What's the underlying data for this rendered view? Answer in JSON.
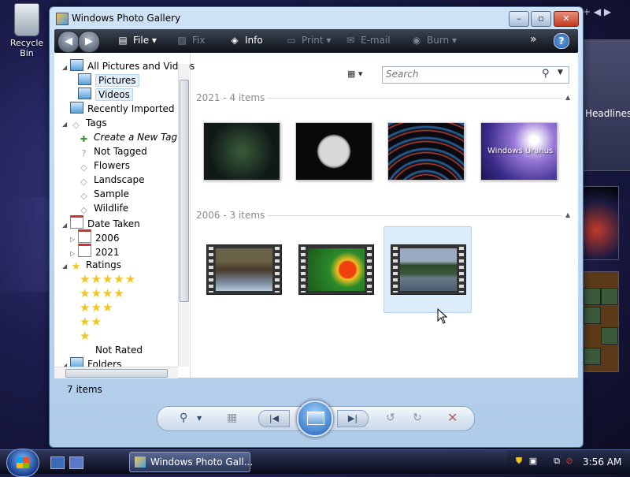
{
  "desktop": {
    "recycle_bin_label": "Recycle Bin",
    "gadget_headlines_label": "Headlines"
  },
  "window": {
    "title": "Windows Photo Gallery",
    "minimize": "–",
    "maximize": "▫",
    "close": "✕"
  },
  "toolbar": {
    "back": "◀",
    "forward": "▶",
    "file": "File",
    "fix": "Fix",
    "info": "Info",
    "print": "Print",
    "email": "E-mail",
    "burn": "Burn",
    "more": "»",
    "help": "?"
  },
  "search": {
    "placeholder": "Search"
  },
  "nav": {
    "all_pictures": "All Pictures and Videos",
    "pictures": "Pictures",
    "videos": "Videos",
    "recently_imported": "Recently Imported",
    "tags": "Tags",
    "create_tag": "Create a New Tag",
    "not_tagged": "Not Tagged",
    "flowers": "Flowers",
    "landscape": "Landscape",
    "sample": "Sample",
    "wildlife": "Wildlife",
    "date_taken": "Date Taken",
    "year_2006": "2006",
    "year_2021": "2021",
    "ratings": "Ratings",
    "stars_5": "★★★★★",
    "stars_4": "★★★★",
    "stars_3": "★★★",
    "stars_2": "★★",
    "stars_1": "★",
    "not_rated": "Not Rated",
    "folders": "Folders"
  },
  "groups": [
    {
      "heading": "2021 - 4 items"
    },
    {
      "heading": "2006 - 3 items"
    }
  ],
  "thumbnails": {
    "windows_uranus_text": "Windows Uranus"
  },
  "status": {
    "count": "7 items"
  },
  "controls": {
    "zoom": "⚲",
    "grid": "▦",
    "prev": "|◀",
    "next": "▶|",
    "rotate_left": "↺",
    "rotate_right": "↻",
    "delete": "✕"
  },
  "taskbar": {
    "task_label": "Windows Photo Gall...",
    "clock": "3:56 AM"
  },
  "colors": {
    "accent": "#1c5fb8",
    "toolbar_bg": "#0d1117",
    "selection": "#dcecfb"
  }
}
